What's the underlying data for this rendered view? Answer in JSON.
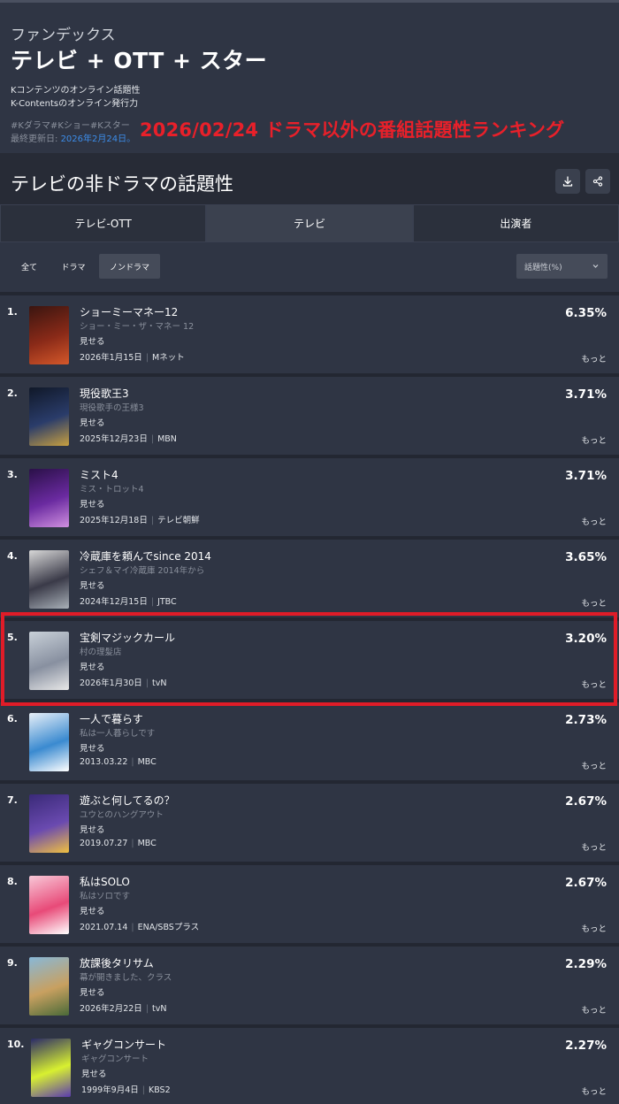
{
  "header": {
    "subtitle": "ファンデックス",
    "title": "テレビ + OTT + スター",
    "desc_line1": "Kコンテンツのオンライン話題性",
    "desc_line2": "K-Contentsのオンライン発行力",
    "tags": "#Kダラマ#Kショー#Kスター",
    "updated_label": "最終更新日:",
    "updated_date": "2026年2月24日。",
    "overlay_caption": "2026/02/24 ドラマ以外の番組話題性ランキング"
  },
  "section": {
    "title": "テレビの非ドラマの話題性",
    "download_icon": "download-icon",
    "share_icon": "share-icon"
  },
  "tabs": [
    {
      "label": "テレビ-OTT"
    },
    {
      "label": "テレビ"
    },
    {
      "label": "出演者"
    }
  ],
  "filters": {
    "chips": [
      {
        "label": "全て"
      },
      {
        "label": "ドラマ"
      },
      {
        "label": "ノンドラマ"
      }
    ],
    "select_value": "話題性(%)"
  },
  "more_label": "もっと",
  "items": [
    {
      "rank": "1.",
      "title": "ショーミーマネー12",
      "subtitle": "ショー・ミー・ザ・マネー 12",
      "genre": "見せる",
      "date": "2026年1月15日",
      "network": "Mネット",
      "score": "6.35%",
      "colors": [
        "#3a1510",
        "#8a2a18",
        "#d4582a"
      ]
    },
    {
      "rank": "2.",
      "title": "現役歌王3",
      "subtitle": "現役歌手の王様3",
      "genre": "見せる",
      "date": "2025年12月23日",
      "network": "MBN",
      "score": "3.71%",
      "colors": [
        "#101828",
        "#2a3c6a",
        "#c8a040"
      ]
    },
    {
      "rank": "3.",
      "title": "ミスト4",
      "subtitle": "ミス・トロット4",
      "genre": "見せる",
      "date": "2025年12月18日",
      "network": "テレビ朝鮮",
      "score": "3.71%",
      "colors": [
        "#2a1048",
        "#6a2aa0",
        "#d090e0"
      ]
    },
    {
      "rank": "4.",
      "title": "冷蔵庫を頼んでsince 2014",
      "subtitle": "シェフ＆マイ冷蔵庫 2014年から",
      "genre": "見せる",
      "date": "2024年12月15日",
      "network": "JTBC",
      "score": "3.65%",
      "colors": [
        "#d8d8d8",
        "#3a3a48",
        "#a8b0b8"
      ]
    },
    {
      "rank": "5.",
      "title": "宝剣マジックカール",
      "subtitle": "村の理髪店",
      "genre": "見せる",
      "date": "2026年1月30日",
      "network": "tvN",
      "score": "3.20%",
      "colors": [
        "#c8d0d8",
        "#8890a0",
        "#e8e8e8"
      ]
    },
    {
      "rank": "6.",
      "title": "一人で暮らす",
      "subtitle": "私は一人暮らしです",
      "genre": "見せる",
      "date": "2013.03.22",
      "network": "MBC",
      "score": "2.73%",
      "colors": [
        "#e8f0f8",
        "#3a8ad0",
        "#ffffff"
      ]
    },
    {
      "rank": "7.",
      "title": "遊ぶと何してるの？",
      "subtitle": "ユウとのハングアウト",
      "genre": "見せる",
      "date": "2019.07.27",
      "network": "MBC",
      "score": "2.67%",
      "colors": [
        "#3a2a78",
        "#6a4ab0",
        "#f0c040"
      ]
    },
    {
      "rank": "8.",
      "title": "私はSOLO",
      "subtitle": "私はソロです",
      "genre": "見せる",
      "date": "2021.07.14",
      "network": "ENA/SBSプラス",
      "score": "2.67%",
      "colors": [
        "#f8c8d8",
        "#e84a78",
        "#ffffff"
      ]
    },
    {
      "rank": "9.",
      "title": "放課後タリサム",
      "subtitle": "幕が開きました、クラス",
      "genre": "見せる",
      "date": "2026年2月22日",
      "network": "tvN",
      "score": "2.29%",
      "colors": [
        "#88b8d8",
        "#c8a060",
        "#4a6a38"
      ]
    },
    {
      "rank": "10.",
      "title": "ギャグコンサート",
      "subtitle": "ギャグコンサート",
      "genre": "見せる",
      "date": "1999年9月4日",
      "network": "KBS2",
      "score": "2.27%",
      "colors": [
        "#2a2a68",
        "#d8f030",
        "#5a3ab0"
      ]
    }
  ]
}
